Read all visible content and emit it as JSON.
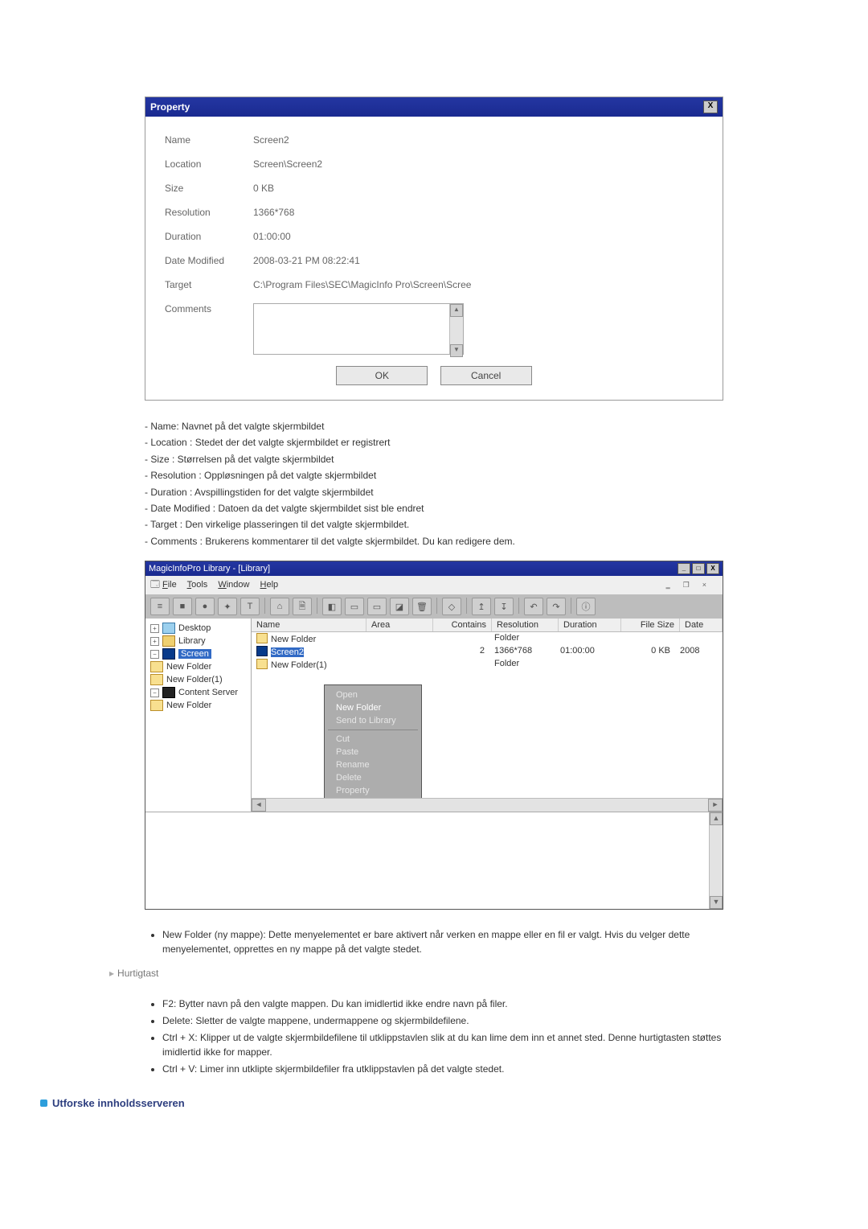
{
  "property_dialog": {
    "title": "Property",
    "close": "X",
    "labels": {
      "name": "Name",
      "location": "Location",
      "size": "Size",
      "resolution": "Resolution",
      "duration": "Duration",
      "date_modified": "Date Modified",
      "target": "Target",
      "comments": "Comments"
    },
    "values": {
      "name": "Screen2",
      "location": "Screen\\Screen2",
      "size": "0 KB",
      "resolution": "1366*768",
      "duration": "01:00:00",
      "date_modified": "2008-03-21 PM 08:22:41",
      "target": "C:\\Program Files\\SEC\\MagicInfo Pro\\Screen\\Scree"
    },
    "buttons": {
      "ok": "OK",
      "cancel": "Cancel"
    }
  },
  "definitions": {
    "name": "- Name: Navnet på det valgte skjermbildet",
    "location": "- Location : Stedet der det valgte skjermbildet er registrert",
    "size": "- Size : Størrelsen på det valgte skjermbildet",
    "resolution": "- Resolution : Oppløsningen på det valgte skjermbildet",
    "duration": "- Duration : Avspillingstiden for det valgte skjermbildet",
    "date_modified": "- Date Modified : Datoen da det valgte skjermbildet sist ble endret",
    "target": "- Target : Den virkelige plasseringen til det valgte skjermbildet.",
    "comments": "- Comments : Brukerens kommentarer til det valgte skjermbildet. Du kan redigere dem."
  },
  "app": {
    "title": "MagicInfoPro Library - [Library]",
    "win_btns": {
      "min": "_",
      "max": "□",
      "close": "X"
    },
    "child_btns": {
      "min": "‗",
      "max": "❐",
      "close": "×"
    },
    "menus": {
      "file": "File",
      "tools": "Tools",
      "window": "Window",
      "help": "Help"
    },
    "toolbar_icons": [
      "≡",
      "■",
      "●",
      "✦",
      "T",
      "⌂",
      "🗎",
      "◧",
      "▭",
      "▭",
      "◪",
      "🗑",
      "◇",
      "↥",
      "↧",
      "↶",
      "↷",
      "ⓘ"
    ],
    "tree": {
      "desktop": "Desktop",
      "library": "Library",
      "screen": "Screen",
      "new_folder": "New Folder",
      "new_folder1": "New Folder(1)",
      "content_server": "Content Server",
      "new_folder_cs": "New Folder"
    },
    "list": {
      "cols": {
        "name": "Name",
        "area": "Area",
        "contains": "Contains",
        "resolution": "Resolution",
        "duration": "Duration",
        "file_size": "File Size",
        "date": "Date"
      },
      "rows": [
        {
          "name": "New Folder",
          "contains": "",
          "resolution": "Folder",
          "duration": "",
          "file_size": "",
          "date": ""
        },
        {
          "name": "Screen2",
          "contains": "2",
          "resolution": "1366*768",
          "duration": "01:00:00",
          "file_size": "0 KB",
          "date": "2008"
        },
        {
          "name": "New Folder(1)",
          "contains": "",
          "resolution": "Folder",
          "duration": "",
          "file_size": "",
          "date": ""
        }
      ]
    },
    "context_menu": {
      "open": "Open",
      "new_folder": "New Folder",
      "send_to_library": "Send to Library",
      "cut": "Cut",
      "paste": "Paste",
      "rename": "Rename",
      "delete": "Delete",
      "property": "Property"
    }
  },
  "notes": {
    "new_folder": "New Folder (ny mappe): Dette menyelementet er bare aktivert når verken en mappe eller en fil er valgt. Hvis du velger dette menyelementet, opprettes en ny mappe på det valgte stedet.",
    "hotkey_heading": "Hurtigtast",
    "hotkeys": {
      "f2": "F2: Bytter navn på den valgte mappen. Du kan imidlertid ikke endre navn på filer.",
      "del": "Delete: Sletter de valgte mappene, undermappene og skjermbildefilene.",
      "ctrlx": "Ctrl + X: Klipper ut de valgte skjermbildefilene til utklippstavlen slik at du kan lime dem inn et annet sted. Denne hurtigtasten støttes imidlertid ikke for mapper.",
      "ctrlv": "Ctrl + V: Limer inn utklipte skjermbildefiler fra utklippstavlen på det valgte stedet."
    }
  },
  "section_heading": "Utforske innholdsserveren"
}
